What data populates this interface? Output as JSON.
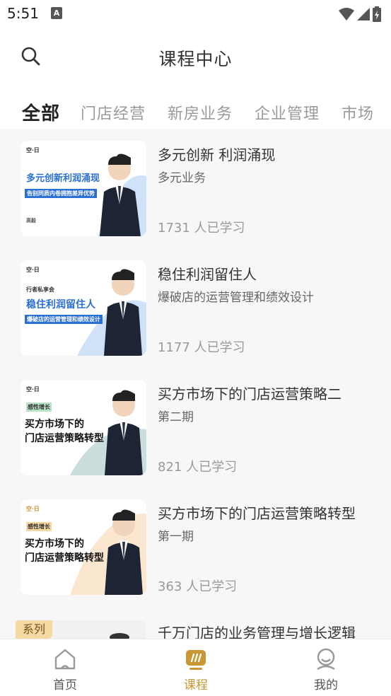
{
  "status_bar": {
    "time": "5:51",
    "notif_icon_letter": "A"
  },
  "header": {
    "title": "课程中心"
  },
  "tabs": [
    {
      "label": "全部",
      "active": true
    },
    {
      "label": "门店经营",
      "active": false
    },
    {
      "label": "新房业务",
      "active": false
    },
    {
      "label": "企业管理",
      "active": false
    },
    {
      "label": "市场",
      "active": false
    }
  ],
  "courses": [
    {
      "title": "多元创新 利润涌现",
      "subtitle": "多元业务",
      "count": "1731 人已学习",
      "thumb": {
        "logo": "空·日",
        "headline": "多元创新利润涌现",
        "banner": "告别同质内卷拥抱差异优势",
        "footer": "高毅",
        "accent": "#2a6fd6"
      }
    },
    {
      "title": "稳住利润留住人",
      "subtitle": "爆破店的运营管理和绩效设计",
      "count": "1177 人已学习",
      "thumb": {
        "logo": "空·日",
        "tag": "行者私享会",
        "headline": "稳住利润留住人",
        "banner": "爆破店的运营管理和绩效设计",
        "accent": "#2a6fd6"
      }
    },
    {
      "title": "买方市场下的门店运营策略二",
      "subtitle": "第二期",
      "count": "821 人已学习",
      "thumb": {
        "logo": "空·日",
        "tag": "感性增长",
        "headline_line1": "买方市场下的",
        "headline_line2": "门店运营策略转型",
        "accent": "#3a8a86"
      }
    },
    {
      "title": "买方市场下的门店运营策略转型",
      "subtitle": "第一期",
      "count": "363 人已学习",
      "thumb": {
        "logo": "空·日",
        "tag": "感性增长",
        "headline_line1": "买方市场下的",
        "headline_line2": "门店运营策略转型",
        "accent": "#e8a257"
      }
    },
    {
      "title": "千万门店的业务管理与增长逻辑",
      "badge": "系列"
    }
  ],
  "bottom_nav": [
    {
      "label": "首页",
      "icon": "home-icon",
      "active": false
    },
    {
      "label": "课程",
      "icon": "course-icon",
      "active": true
    },
    {
      "label": "我的",
      "icon": "profile-icon",
      "active": false
    }
  ],
  "colors": {
    "accent": "#c89736",
    "list_bg": "#f7f7f7"
  }
}
